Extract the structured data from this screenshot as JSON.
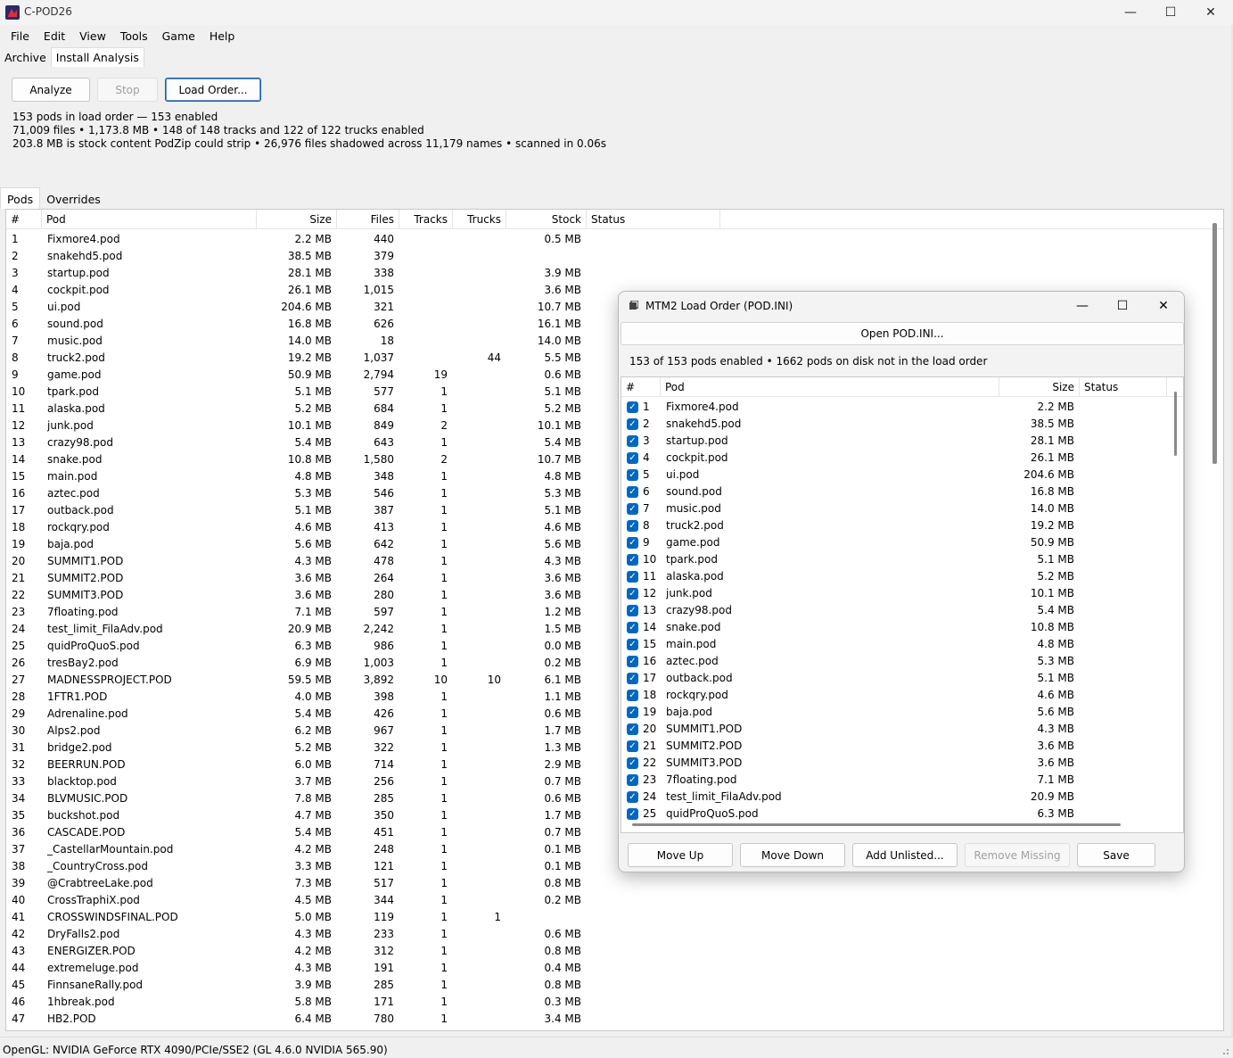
{
  "window": {
    "title": "C-POD26",
    "minimize": "—",
    "maximize": "☐",
    "close": "✕"
  },
  "menu": [
    "File",
    "Edit",
    "View",
    "Tools",
    "Game",
    "Help"
  ],
  "main_tabs": [
    "Archive",
    "Install Analysis"
  ],
  "toolbar": {
    "analyze": "Analyze",
    "stop": "Stop",
    "load_order": "Load Order..."
  },
  "summary": {
    "line1": "153 pods in load order — 153 enabled",
    "line2": "71,009 files  •  1,173.8 MB  •  148 of 148 tracks and 122 of 122 trucks enabled",
    "line3": "203.8 MB is stock content PodZip could strip  •  26,976 files shadowed across 11,179 names  •  scanned in 0.06s"
  },
  "sub_tabs": [
    "Pods",
    "Overrides"
  ],
  "pods_table": {
    "headers": {
      "num": "#",
      "pod": "Pod",
      "size": "Size",
      "files": "Files",
      "tracks": "Tracks",
      "trucks": "Trucks",
      "stock": "Stock",
      "status": "Status"
    },
    "rows": [
      [
        "1",
        "Fixmore4.pod",
        "2.2 MB",
        "440",
        "",
        "",
        "0.5 MB"
      ],
      [
        "2",
        "snakehd5.pod",
        "38.5 MB",
        "379",
        "",
        "",
        ""
      ],
      [
        "3",
        "startup.pod",
        "28.1 MB",
        "338",
        "",
        "",
        "3.9 MB"
      ],
      [
        "4",
        "cockpit.pod",
        "26.1 MB",
        "1,015",
        "",
        "",
        "3.6 MB"
      ],
      [
        "5",
        "ui.pod",
        "204.6 MB",
        "321",
        "",
        "",
        "10.7 MB"
      ],
      [
        "6",
        "sound.pod",
        "16.8 MB",
        "626",
        "",
        "",
        "16.1 MB"
      ],
      [
        "7",
        "music.pod",
        "14.0 MB",
        "18",
        "",
        "",
        "14.0 MB"
      ],
      [
        "8",
        "truck2.pod",
        "19.2 MB",
        "1,037",
        "",
        "44",
        "5.5 MB"
      ],
      [
        "9",
        "game.pod",
        "50.9 MB",
        "2,794",
        "19",
        "",
        "0.6 MB"
      ],
      [
        "10",
        "tpark.pod",
        "5.1 MB",
        "577",
        "1",
        "",
        "5.1 MB"
      ],
      [
        "11",
        "alaska.pod",
        "5.2 MB",
        "684",
        "1",
        "",
        "5.2 MB"
      ],
      [
        "12",
        "junk.pod",
        "10.1 MB",
        "849",
        "2",
        "",
        "10.1 MB"
      ],
      [
        "13",
        "crazy98.pod",
        "5.4 MB",
        "643",
        "1",
        "",
        "5.4 MB"
      ],
      [
        "14",
        "snake.pod",
        "10.8 MB",
        "1,580",
        "2",
        "",
        "10.7 MB"
      ],
      [
        "15",
        "main.pod",
        "4.8 MB",
        "348",
        "1",
        "",
        "4.8 MB"
      ],
      [
        "16",
        "aztec.pod",
        "5.3 MB",
        "546",
        "1",
        "",
        "5.3 MB"
      ],
      [
        "17",
        "outback.pod",
        "5.1 MB",
        "387",
        "1",
        "",
        "5.1 MB"
      ],
      [
        "18",
        "rockqry.pod",
        "4.6 MB",
        "413",
        "1",
        "",
        "4.6 MB"
      ],
      [
        "19",
        "baja.pod",
        "5.6 MB",
        "642",
        "1",
        "",
        "5.6 MB"
      ],
      [
        "20",
        "SUMMIT1.POD",
        "4.3 MB",
        "478",
        "1",
        "",
        "4.3 MB"
      ],
      [
        "21",
        "SUMMIT2.POD",
        "3.6 MB",
        "264",
        "1",
        "",
        "3.6 MB"
      ],
      [
        "22",
        "SUMMIT3.POD",
        "3.6 MB",
        "280",
        "1",
        "",
        "3.6 MB"
      ],
      [
        "23",
        "7floating.pod",
        "7.1 MB",
        "597",
        "1",
        "",
        "1.2 MB"
      ],
      [
        "24",
        "test_limit_FilaAdv.pod",
        "20.9 MB",
        "2,242",
        "1",
        "",
        "1.5 MB"
      ],
      [
        "25",
        "quidProQuoS.pod",
        "6.3 MB",
        "986",
        "1",
        "",
        "0.0 MB"
      ],
      [
        "26",
        "tresBay2.pod",
        "6.9 MB",
        "1,003",
        "1",
        "",
        "0.2 MB"
      ],
      [
        "27",
        "MADNESSPROJECT.POD",
        "59.5 MB",
        "3,892",
        "10",
        "10",
        "6.1 MB"
      ],
      [
        "28",
        "1FTR1.POD",
        "4.0 MB",
        "398",
        "1",
        "",
        "1.1 MB"
      ],
      [
        "29",
        "Adrenaline.pod",
        "5.4 MB",
        "426",
        "1",
        "",
        "0.6 MB"
      ],
      [
        "30",
        "Alps2.pod",
        "6.2 MB",
        "967",
        "1",
        "",
        "1.7 MB"
      ],
      [
        "31",
        "bridge2.pod",
        "5.2 MB",
        "322",
        "1",
        "",
        "1.3 MB"
      ],
      [
        "32",
        "BEERRUN.POD",
        "6.0 MB",
        "714",
        "1",
        "",
        "2.9 MB"
      ],
      [
        "33",
        "blacktop.pod",
        "3.7 MB",
        "256",
        "1",
        "",
        "0.7 MB"
      ],
      [
        "34",
        "BLVMUSIC.POD",
        "7.8 MB",
        "285",
        "1",
        "",
        "0.6 MB"
      ],
      [
        "35",
        "buckshot.pod",
        "4.7 MB",
        "350",
        "1",
        "",
        "1.7 MB"
      ],
      [
        "36",
        "CASCADE.POD",
        "5.4 MB",
        "451",
        "1",
        "",
        "0.7 MB"
      ],
      [
        "37",
        "_CastellarMountain.pod",
        "4.2 MB",
        "248",
        "1",
        "",
        "0.1 MB"
      ],
      [
        "38",
        "_CountryCross.pod",
        "3.3 MB",
        "121",
        "1",
        "",
        "0.1 MB"
      ],
      [
        "39",
        "@CrabtreeLake.pod",
        "7.3 MB",
        "517",
        "1",
        "",
        "0.8 MB"
      ],
      [
        "40",
        "CrossTraphiX.pod",
        "4.5 MB",
        "344",
        "1",
        "",
        "0.2 MB"
      ],
      [
        "41",
        "CROSSWINDSFINAL.POD",
        "5.0 MB",
        "119",
        "1",
        "1",
        ""
      ],
      [
        "42",
        "DryFalls2.pod",
        "4.3 MB",
        "233",
        "1",
        "",
        "0.6 MB"
      ],
      [
        "43",
        "ENERGIZER.POD",
        "4.2 MB",
        "312",
        "1",
        "",
        "0.8 MB"
      ],
      [
        "44",
        "extremeluge.pod",
        "4.3 MB",
        "191",
        "1",
        "",
        "0.4 MB"
      ],
      [
        "45",
        "FinnsaneRally.pod",
        "3.9 MB",
        "285",
        "1",
        "",
        "0.8 MB"
      ],
      [
        "46",
        "1hbreak.pod",
        "5.8 MB",
        "171",
        "1",
        "",
        "0.3 MB"
      ],
      [
        "47",
        "HB2.POD",
        "6.4 MB",
        "780",
        "1",
        "",
        "3.4 MB"
      ]
    ]
  },
  "statusbar": "OpenGL: NVIDIA GeForce RTX 4090/PCIe/SSE2 (GL 4.6.0 NVIDIA 565.90)",
  "dialog": {
    "title": "MTM2 Load Order (POD.INI)",
    "open_button": "Open POD.INI...",
    "info": "153 of 153 pods enabled  •  1662 pods on disk not in the load order",
    "headers": {
      "num": "#",
      "pod": "Pod",
      "size": "Size",
      "status": "Status"
    },
    "rows": [
      [
        "1",
        "Fixmore4.pod",
        "2.2 MB"
      ],
      [
        "2",
        "snakehd5.pod",
        "38.5 MB"
      ],
      [
        "3",
        "startup.pod",
        "28.1 MB"
      ],
      [
        "4",
        "cockpit.pod",
        "26.1 MB"
      ],
      [
        "5",
        "ui.pod",
        "204.6 MB"
      ],
      [
        "6",
        "sound.pod",
        "16.8 MB"
      ],
      [
        "7",
        "music.pod",
        "14.0 MB"
      ],
      [
        "8",
        "truck2.pod",
        "19.2 MB"
      ],
      [
        "9",
        "game.pod",
        "50.9 MB"
      ],
      [
        "10",
        "tpark.pod",
        "5.1 MB"
      ],
      [
        "11",
        "alaska.pod",
        "5.2 MB"
      ],
      [
        "12",
        "junk.pod",
        "10.1 MB"
      ],
      [
        "13",
        "crazy98.pod",
        "5.4 MB"
      ],
      [
        "14",
        "snake.pod",
        "10.8 MB"
      ],
      [
        "15",
        "main.pod",
        "4.8 MB"
      ],
      [
        "16",
        "aztec.pod",
        "5.3 MB"
      ],
      [
        "17",
        "outback.pod",
        "5.1 MB"
      ],
      [
        "18",
        "rockqry.pod",
        "4.6 MB"
      ],
      [
        "19",
        "baja.pod",
        "5.6 MB"
      ],
      [
        "20",
        "SUMMIT1.POD",
        "4.3 MB"
      ],
      [
        "21",
        "SUMMIT2.POD",
        "3.6 MB"
      ],
      [
        "22",
        "SUMMIT3.POD",
        "3.6 MB"
      ],
      [
        "23",
        "7floating.pod",
        "7.1 MB"
      ],
      [
        "24",
        "test_limit_FilaAdv.pod",
        "20.9 MB"
      ],
      [
        "25",
        "quidProQuoS.pod",
        "6.3 MB"
      ]
    ],
    "buttons": {
      "move_up": "Move Up",
      "move_down": "Move Down",
      "add_unlisted": "Add Unlisted...",
      "remove_missing": "Remove Missing",
      "save": "Save"
    },
    "check_glyph": "✓"
  }
}
